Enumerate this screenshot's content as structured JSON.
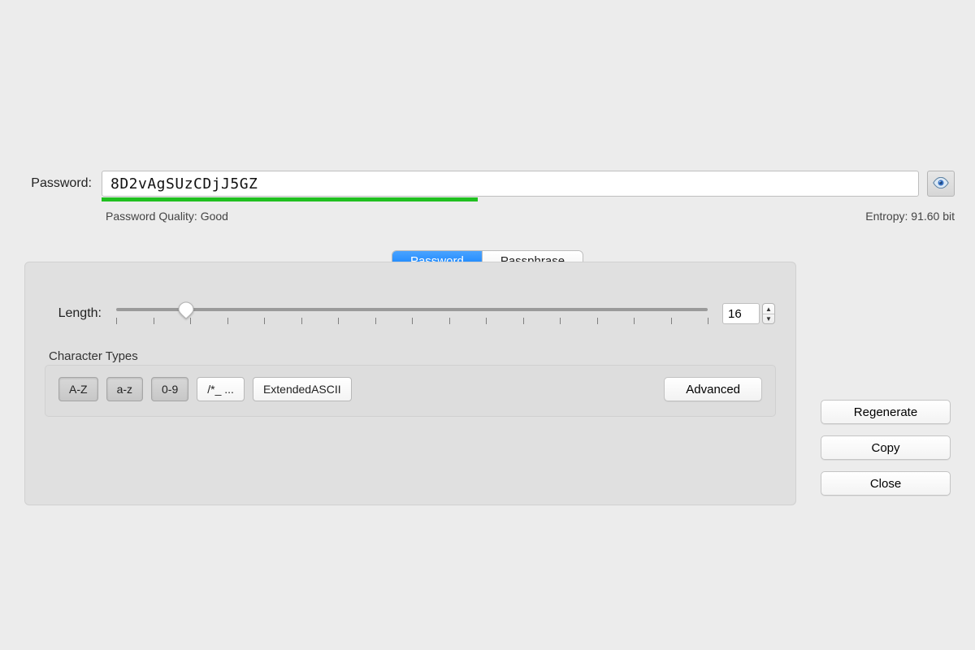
{
  "password_row": {
    "label": "Password:",
    "value": "8D2vAgSUzCDjJ5GZ",
    "quality_pct": 46
  },
  "meta": {
    "quality_text": "Password Quality: Good",
    "entropy_text": "Entropy: 91.60 bit"
  },
  "tabs": {
    "password": "Password",
    "passphrase": "Passphrase",
    "selected": "password"
  },
  "length": {
    "label": "Length:",
    "value": "16",
    "min": 1,
    "max": 128,
    "tick_count": 17
  },
  "charset": {
    "group_title": "Character Types",
    "items": [
      {
        "id": "upper",
        "label": "A-Z",
        "active": true
      },
      {
        "id": "lower",
        "label": "a-z",
        "active": true
      },
      {
        "id": "digits",
        "label": "0-9",
        "active": true
      },
      {
        "id": "symbols",
        "label": "/*_ ...",
        "active": false
      },
      {
        "id": "extascii",
        "label": "ExtendedASCII",
        "active": false
      }
    ],
    "advanced_label": "Advanced"
  },
  "actions": {
    "regenerate": "Regenerate",
    "copy": "Copy",
    "close": "Close"
  }
}
